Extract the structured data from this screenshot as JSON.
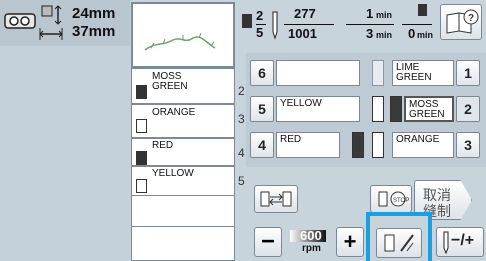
{
  "header": {
    "width": "24mm",
    "height": "37mm"
  },
  "status": {
    "current_color": "2",
    "total_colors": "5",
    "stitch_current": "277",
    "stitch_total": "1001",
    "time_current": "1",
    "time_total": "3",
    "time_unit": "min",
    "remaining": "0",
    "remaining_unit": "min"
  },
  "color_list": [
    {
      "name": "MOSS GREEN",
      "name_line1": "MOSS",
      "name_line2": "GREEN",
      "index": "2",
      "color": "#3a3a3a"
    },
    {
      "name": "ORANGE",
      "index": "3",
      "color": "#ffffff"
    },
    {
      "name": "RED",
      "index": "4",
      "color": "#3a3a3a"
    },
    {
      "name": "YELLOW",
      "index": "5",
      "color": "#ffffff"
    }
  ],
  "panel": {
    "rows": [
      {
        "left_num": "6",
        "left_name": "",
        "right_name_l1": "LIME",
        "right_name_l2": "GREEN",
        "right_num": "1"
      },
      {
        "left_num": "5",
        "left_name": "YELLOW",
        "right_name_l1": "MOSS",
        "right_name_l2": "GREEN",
        "right_num": "2"
      },
      {
        "left_num": "4",
        "left_name": "RED",
        "right_name_l1": "ORANGE",
        "right_name_l2": "",
        "right_num": "3"
      }
    ]
  },
  "controls": {
    "cancel_label_l1": "取消",
    "cancel_label_l2": "缝制",
    "speed_value": "600",
    "speed_unit": "rpm",
    "minus_label": "−",
    "plus_label": "+",
    "tension_label": "−/+"
  },
  "colors": {
    "accent": "#1aa0e0",
    "background": "#c8d4dc"
  }
}
